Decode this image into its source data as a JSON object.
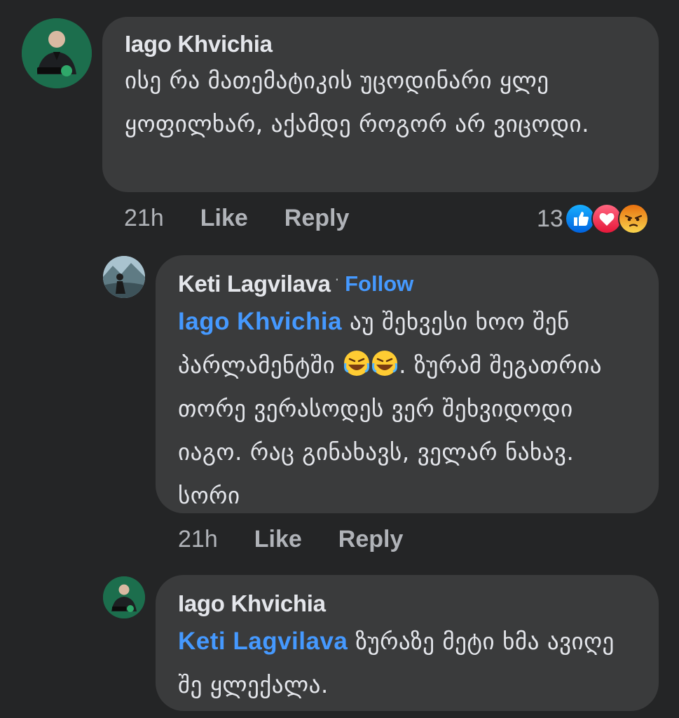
{
  "comments": [
    {
      "author": "Iago Khvichia",
      "text": "ისე რა მათემატიკის უცოდინარი ყლე ყოფილხარ, აქამდე როგორ არ ვიცოდი.",
      "time": "21h",
      "like_label": "Like",
      "reply_label": "Reply",
      "reaction_count": "13",
      "reaction_icons": [
        "like-reaction-icon",
        "love-reaction-icon",
        "angry-reaction-icon"
      ]
    },
    {
      "author": "Keti Lagvilava",
      "dot": "·",
      "follow_label": "Follow",
      "mention": "Iago Khvichia",
      "text_part1": " აუ შეხვესი ხოო შენ პარლამენტში ",
      "text_part2": ". ზურამ შეგათრია თორე ვერასოდეს ვერ შეხვიდოდი იაგო. რაც გინახავს, ველარ ნახავ. სორი",
      "emojis": [
        "rolling-laughing-emoji",
        "rolling-laughing-emoji"
      ],
      "time": "21h",
      "like_label": "Like",
      "reply_label": "Reply"
    },
    {
      "author": "Iago Khvichia",
      "mention": "Keti Lagvilava",
      "text": " ზურაზე მეტი ხმა ავიღე შე ყლექალა."
    }
  ],
  "colors": {
    "background": "#242526",
    "bubble": "#3a3b3c",
    "text": "#e4e6eb",
    "secondary": "#b0b3b8",
    "link": "#4599ff"
  }
}
